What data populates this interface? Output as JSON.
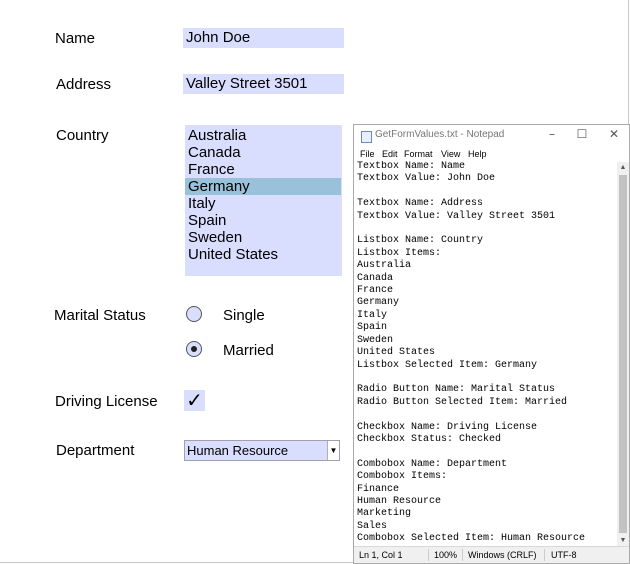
{
  "form": {
    "name_label": "Name",
    "name_value": "John Doe",
    "address_label": "Address",
    "address_value": "Valley Street 3501",
    "country_label": "Country",
    "countries": [
      "Australia",
      "Canada",
      "France",
      "Germany",
      "Italy",
      "Spain",
      "Sweden",
      "United States"
    ],
    "selected_country": "Germany",
    "marital_label": "Marital Status",
    "marital_options": [
      "Single",
      "Married"
    ],
    "marital_selected": "Married",
    "license_label": "Driving License",
    "license_checked": true,
    "license_check_glyph": "✓",
    "department_label": "Department",
    "department_value": "Human Resource"
  },
  "notepad": {
    "title": "GetFormValues.txt - Notepad",
    "menu": [
      "File",
      "Edit",
      "Format",
      "View",
      "Help"
    ],
    "lines": [
      "Textbox Name: Name",
      "Textbox Value: John Doe",
      "",
      "Textbox Name: Address",
      "Textbox Value: Valley Street 3501",
      "",
      "Listbox Name: Country",
      "Listbox Items:",
      "Australia",
      "Canada",
      "France",
      "Germany",
      "Italy",
      "Spain",
      "Sweden",
      "United States",
      "Listbox Selected Item: Germany",
      "",
      "Radio Button Name: Marital Status",
      "Radio Button Selected Item: Married",
      "",
      "Checkbox Name: Driving License",
      "Checkbox Status: Checked",
      "",
      "Combobox Name: Department",
      "Combobox Items:",
      "Finance",
      "Human Resource",
      "Marketing",
      "Sales",
      "Combobox Selected Item: Human Resource"
    ],
    "status": {
      "position": "Ln 1, Col 1",
      "zoom": "100%",
      "line_ending": "Windows (CRLF)",
      "encoding": "UTF-8"
    }
  }
}
